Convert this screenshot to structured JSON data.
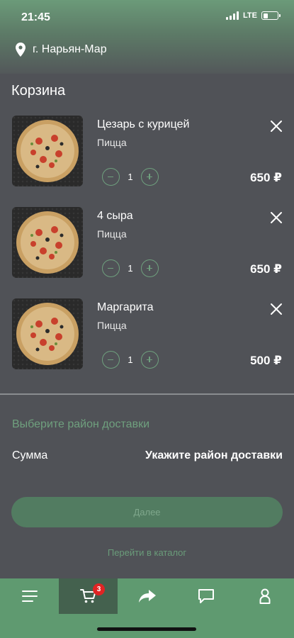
{
  "status_bar": {
    "time": "21:45",
    "network": "LTE",
    "battery_level": 0.35
  },
  "location": {
    "city": "г. Нарьян-Мар",
    "icon": "location-pin-icon"
  },
  "cart": {
    "title": "Корзина",
    "items": [
      {
        "name": "Цезарь с курицей",
        "category": "Пицца",
        "quantity": "1",
        "price": "650 ₽"
      },
      {
        "name": "4 сыра",
        "category": "Пицца",
        "quantity": "1",
        "price": "650 ₽"
      },
      {
        "name": "Маргарита",
        "category": "Пицца",
        "quantity": "1",
        "price": "500 ₽"
      }
    ]
  },
  "delivery": {
    "choose_district": "Выберите район доставки",
    "sum_label": "Сумма",
    "sum_value": "Укажите район доставки"
  },
  "actions": {
    "next_label": "Далее",
    "catalog_link": "Перейти в каталог"
  },
  "tabbar": {
    "items": [
      {
        "icon": "menu-icon"
      },
      {
        "icon": "cart-icon",
        "badge": "3",
        "active": true
      },
      {
        "icon": "share-icon"
      },
      {
        "icon": "chat-icon"
      },
      {
        "icon": "profile-icon"
      }
    ]
  },
  "colors": {
    "accent": "#6fa07e",
    "tabbar": "#5f9a70",
    "background": "#505257",
    "badge": "#e02424"
  }
}
